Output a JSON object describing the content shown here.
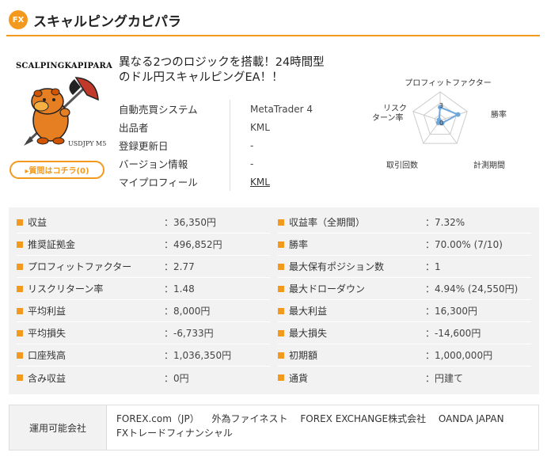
{
  "header": {
    "badge": "FX",
    "title": "スキャルピングカピパラ"
  },
  "product": {
    "logo_text": "SCALPINGKAPIPARA",
    "pair_label": "USDJPY M5",
    "question_button": "▸質問はコチラ(0)"
  },
  "headline": {
    "line1": "異なる2つのロジックを搭載！24時間型",
    "line2": "のドル円スキャルピングEA！！"
  },
  "info": [
    {
      "label": "自動売買システム",
      "value": "MetaTrader 4"
    },
    {
      "label": "出品者",
      "value": "KML"
    },
    {
      "label": "登録更新日",
      "value": "-"
    },
    {
      "label": "バージョン情報",
      "value": "-"
    },
    {
      "label": "マイプロフィール",
      "value": "KML"
    }
  ],
  "radar": {
    "labels": [
      "プロフィットファクター",
      "勝率",
      "計測期間",
      "取引回数",
      "リスク\nターン率"
    ],
    "label_top": "プロフィットファクター",
    "label_right": "勝率",
    "label_bottom_right": "計測期間",
    "label_bottom_left": "取引回数",
    "label_left_1": "リスク",
    "label_left_2": "ターン率",
    "tick_3": "3",
    "tick_0": "0",
    "values": [
      2.3,
      3.3,
      0.6,
      0.5,
      0.2
    ],
    "max": 5,
    "color": "#6fa8dc"
  },
  "stats_left": [
    {
      "label": "収益",
      "value": "：36,350円"
    },
    {
      "label": "推奨証拠金",
      "value": "：496,852円"
    },
    {
      "label": "プロフィットファクター",
      "value": "：2.77"
    },
    {
      "label": "リスクリターン率",
      "value": "：1.48"
    },
    {
      "label": "平均利益",
      "value": "：8,000円"
    },
    {
      "label": "平均損失",
      "value": "：-6,733円"
    },
    {
      "label": "口座残高",
      "value": "：1,036,350円"
    },
    {
      "label": "含み収益",
      "value": "：0円"
    }
  ],
  "stats_right": [
    {
      "label": "収益率（全期間）",
      "value": "：7.32%"
    },
    {
      "label": "勝率",
      "value": "：70.00% (7/10)"
    },
    {
      "label": "最大保有ポジション数",
      "value": "：1"
    },
    {
      "label": "最大ドローダウン",
      "value": "：4.94% (24,550円)"
    },
    {
      "label": "最大利益",
      "value": "：16,300円"
    },
    {
      "label": "最大損失",
      "value": "：-14,600円"
    },
    {
      "label": "初期額",
      "value": "：1,000,000円"
    },
    {
      "label": "通貨",
      "value": "：円建て"
    }
  ],
  "companies": {
    "label": "運用可能会社",
    "line1": [
      "FOREX.com（JP）",
      "外為ファイネスト",
      "FOREX EXCHANGE株式会社",
      "OANDA JAPAN"
    ],
    "line2": [
      "FXトレードフィナンシャル"
    ]
  },
  "colors": {
    "accent": "#f39a1e",
    "radar": "#6fa8dc"
  }
}
